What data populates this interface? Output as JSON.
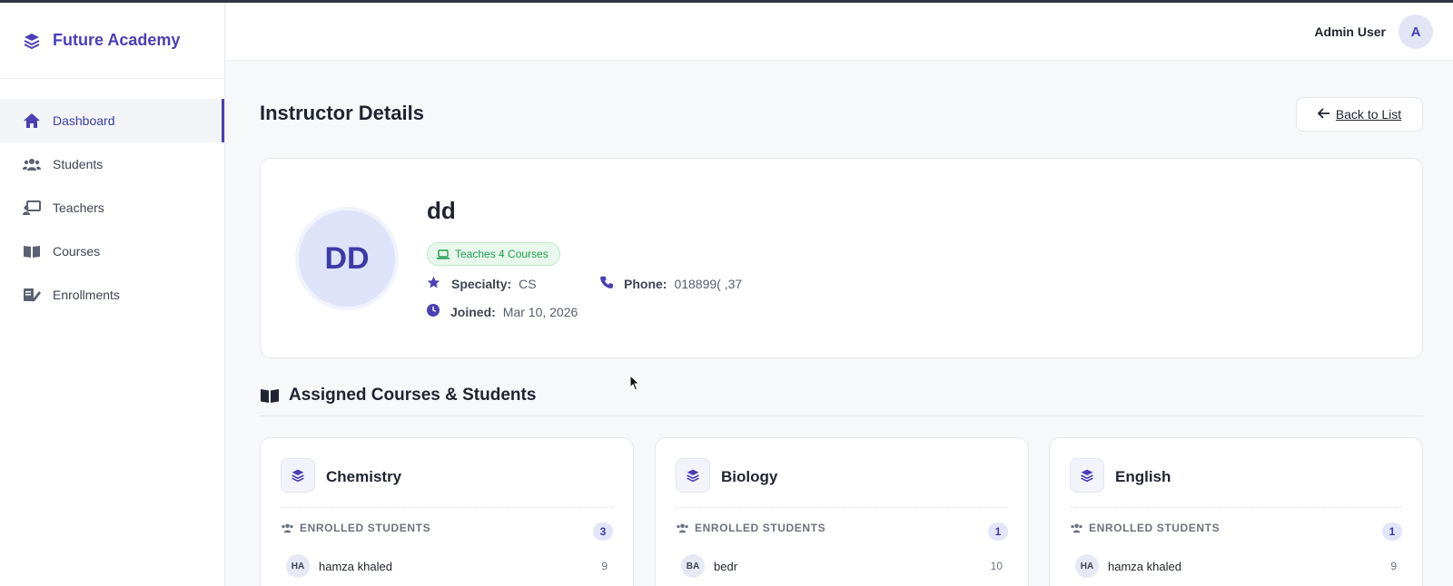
{
  "app": {
    "brand": "Future Academy"
  },
  "header": {
    "user_name": "Admin User",
    "user_initial": "A"
  },
  "sidebar": {
    "items": [
      {
        "label": "Dashboard",
        "icon": "home-icon",
        "active": true
      },
      {
        "label": "Students",
        "icon": "users-icon",
        "active": false
      },
      {
        "label": "Teachers",
        "icon": "chalkboard-teacher-icon",
        "active": false
      },
      {
        "label": "Courses",
        "icon": "book-icon",
        "active": false
      },
      {
        "label": "Enrollments",
        "icon": "edit-list-icon",
        "active": false
      }
    ]
  },
  "page": {
    "title": "Instructor Details",
    "back_label": "Back to List"
  },
  "instructor": {
    "initials": "DD",
    "name": "dd",
    "badge": "Teaches 4 Courses",
    "specialty_label": "Specialty:",
    "specialty": "CS",
    "phone_label": "Phone:",
    "phone": "018899( ,37",
    "joined_label": "Joined:",
    "joined": "Mar 10, 2026"
  },
  "section": {
    "title": "Assigned Courses & Students"
  },
  "courses": [
    {
      "name": "Chemistry",
      "enrolled_label": "ENROLLED STUDENTS",
      "count": "3",
      "students": [
        {
          "initials": "HA",
          "name": "hamza khaled",
          "value": "9"
        }
      ]
    },
    {
      "name": "Biology",
      "enrolled_label": "ENROLLED STUDENTS",
      "count": "1",
      "students": [
        {
          "initials": "BA",
          "name": "bedr",
          "value": "10"
        }
      ]
    },
    {
      "name": "English",
      "enrolled_label": "ENROLLED STUDENTS",
      "count": "1",
      "students": [
        {
          "initials": "HA",
          "name": "hamza khaled",
          "value": "9"
        }
      ]
    }
  ],
  "colors": {
    "accent": "#4a3fb5",
    "badge_green": "#1f9d4f",
    "badge_bg": "#e8f8ec"
  }
}
